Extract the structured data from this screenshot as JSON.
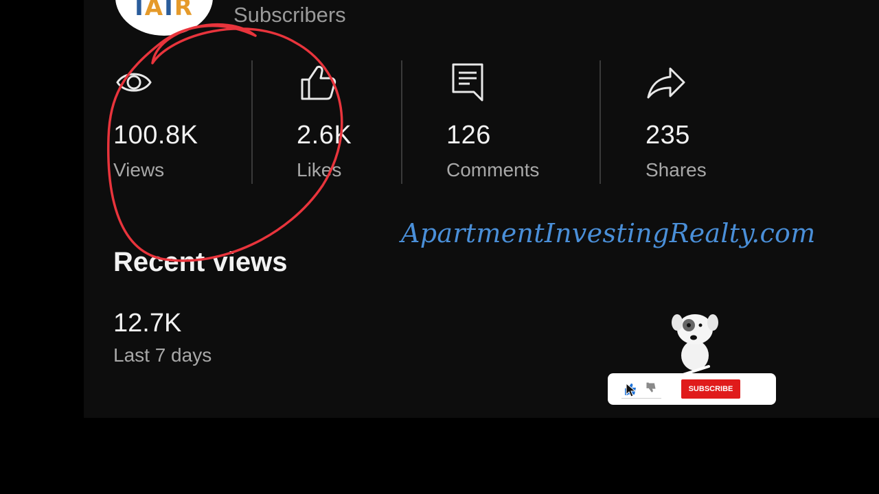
{
  "channel": {
    "avatar_text": "IAIR",
    "subscribers_label": "Subscribers"
  },
  "stats": [
    {
      "icon": "eye-icon",
      "value": "100.8K",
      "label": "Views"
    },
    {
      "icon": "thumbs-up-icon",
      "value": "2.6K",
      "label": "Likes"
    },
    {
      "icon": "comment-icon",
      "value": "126",
      "label": "Comments"
    },
    {
      "icon": "share-icon",
      "value": "235",
      "label": "Shares"
    }
  ],
  "recent": {
    "title": "Recent views",
    "value": "12.7K",
    "period": "Last 7 days"
  },
  "watermark": "ApartmentInvestingRealty.com",
  "overlay": {
    "subscribe_label": "SUBSCRIBE",
    "annotation_color": "#e8343c",
    "accent_color": "#e01b1b"
  }
}
